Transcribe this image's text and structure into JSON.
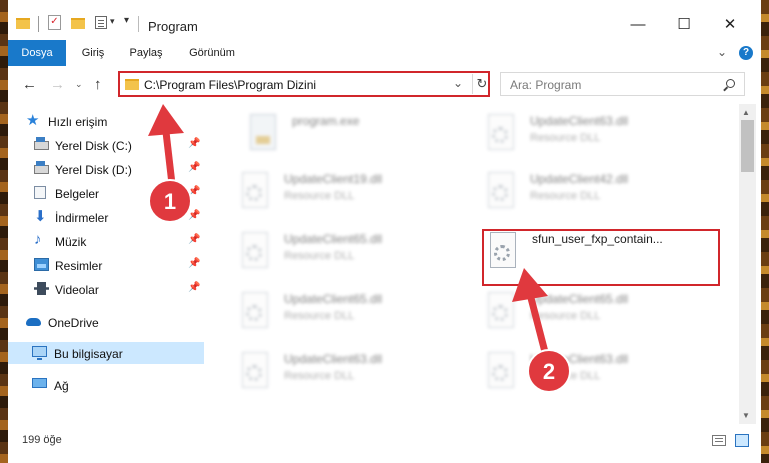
{
  "window": {
    "title": "Program",
    "quick_access_more": "▾",
    "controls": {
      "minimize": "—",
      "maximize": "☐",
      "close": "✕"
    }
  },
  "ribbon": {
    "tabs": [
      "Dosya",
      "Giriş",
      "Paylaş",
      "Görünüm"
    ],
    "collapse_glyph": "⌄",
    "help_glyph": "?"
  },
  "navigation": {
    "back": "←",
    "forward": "→",
    "recent": "⌄",
    "up": "↑",
    "address": "C:\\Program Files\\Program Dizini",
    "address_dropdown": "⌄",
    "refresh": "↻",
    "search_placeholder": "Ara: Program"
  },
  "sidebar": {
    "quick_access": "Hızlı erişim",
    "items": [
      {
        "label": "Yerel Disk (C:)",
        "icon": "drive-icon",
        "pinned": true
      },
      {
        "label": "Yerel Disk (D:)",
        "icon": "drive-icon",
        "pinned": true
      },
      {
        "label": "Belgeler",
        "icon": "documents-icon",
        "pinned": true
      },
      {
        "label": "İndirmeler",
        "icon": "downloads-icon",
        "pinned": true
      },
      {
        "label": "Müzik",
        "icon": "music-icon",
        "pinned": true
      },
      {
        "label": "Resimler",
        "icon": "pictures-icon",
        "pinned": true
      },
      {
        "label": "Videolar",
        "icon": "videos-icon",
        "pinned": true
      }
    ],
    "pin_glyph": "📌",
    "onedrive": "OneDrive",
    "this_pc": "Bu bilgisayar",
    "network": "Ağ"
  },
  "files": [
    {
      "name": "program.exe",
      "type": ""
    },
    {
      "name": "UpdateClient63.dll",
      "type": "Resource DLL"
    },
    {
      "name": "UpdateClient19.dll",
      "type": "Resource DLL"
    },
    {
      "name": "UpdateClient42.dll",
      "type": "Resource DLL"
    },
    {
      "name": "UpdateClient65.dll",
      "type": "Resource DLL"
    },
    {
      "name": "sfun_user_fxp_contain...",
      "type": ""
    },
    {
      "name": "UpdateClient65.dll",
      "type": "Resource DLL"
    },
    {
      "name": "UpdateClient65.dll",
      "type": "Resource DLL"
    },
    {
      "name": "UpdateClient63.dll",
      "type": "Resource DLL"
    },
    {
      "name": "UpdateClient63.dll",
      "type": "Resource DLL"
    }
  ],
  "status": {
    "item_count": "199 öğe"
  },
  "annotations": {
    "step1": "1",
    "step2": "2",
    "color": "#e0393e"
  }
}
